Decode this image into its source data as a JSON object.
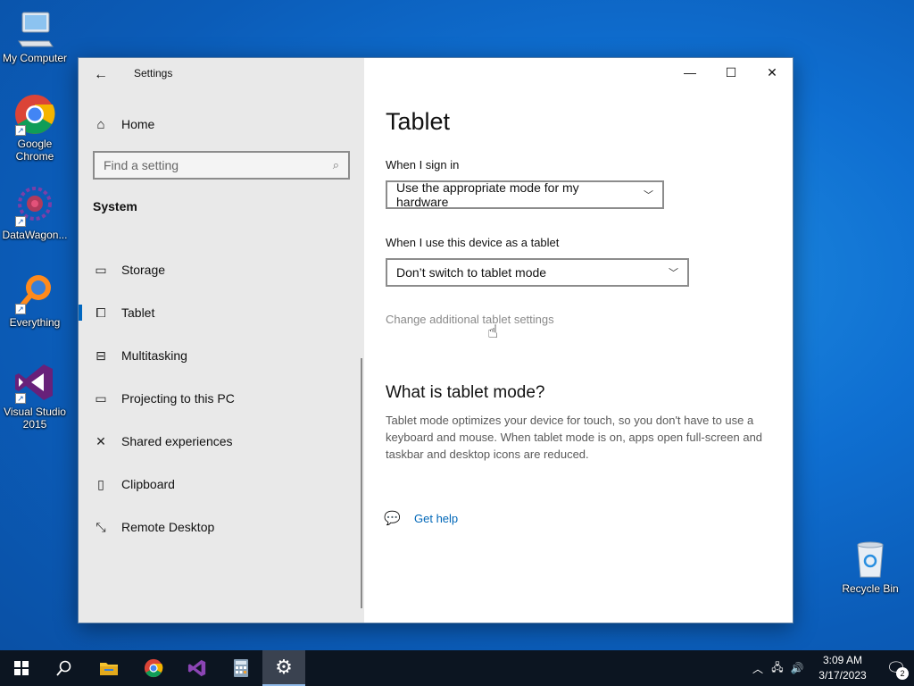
{
  "desktop": {
    "icons": [
      {
        "label": "My Computer",
        "icon": "computer-icon"
      },
      {
        "label": "Google Chrome",
        "icon": "chrome-icon"
      },
      {
        "label": "DataWagon...",
        "icon": "datawagon-icon"
      },
      {
        "label": "Everything",
        "icon": "everything-search-icon"
      },
      {
        "label": "Visual Studio 2015",
        "icon": "visual-studio-icon"
      },
      {
        "label": "Recycle Bin",
        "icon": "recycle-bin-icon"
      }
    ]
  },
  "window": {
    "app_title": "Settings",
    "back_icon": "back-arrow-icon",
    "controls": {
      "minimize": "minimize-icon",
      "maximize": "maximize-icon",
      "close": "close-icon"
    }
  },
  "nav": {
    "home_label": "Home",
    "search_placeholder": "Find a setting",
    "section": "System",
    "items": [
      {
        "label": "Storage",
        "icon": "storage-icon"
      },
      {
        "label": "Tablet",
        "icon": "tablet-icon",
        "active": true
      },
      {
        "label": "Multitasking",
        "icon": "multitasking-icon"
      },
      {
        "label": "Projecting to this PC",
        "icon": "projecting-icon"
      },
      {
        "label": "Shared experiences",
        "icon": "shared-experiences-icon"
      },
      {
        "label": "Clipboard",
        "icon": "clipboard-icon"
      },
      {
        "label": "Remote Desktop",
        "icon": "remote-desktop-icon"
      }
    ]
  },
  "content": {
    "title": "Tablet",
    "signin_label": "When I sign in",
    "signin_value": "Use the appropriate mode for my hardware",
    "tablet_label": "When I use this device as a tablet",
    "tablet_value": "Don’t switch to tablet mode",
    "additional_link": "Change additional tablet settings",
    "what_title": "What is tablet mode?",
    "what_desc": "Tablet mode optimizes your device for touch, so you don't have to use a keyboard and mouse. When tablet mode is on, apps open full-screen and taskbar and desktop icons are reduced.",
    "help_link": "Get help"
  },
  "taskbar": {
    "buttons": [
      "start-icon",
      "search-icon",
      "file-explorer-icon",
      "chrome-icon",
      "visual-studio-icon",
      "calculator-icon",
      "settings-gear-icon"
    ],
    "active": "settings-gear-icon",
    "time": "3:09 AM",
    "date": "3/17/2023",
    "notification_count": "2"
  },
  "colors": {
    "accent": "#0067c0",
    "link": "#0067b8",
    "nav_bg": "#e9e9e9",
    "taskbar_bg": "#0c1521"
  }
}
